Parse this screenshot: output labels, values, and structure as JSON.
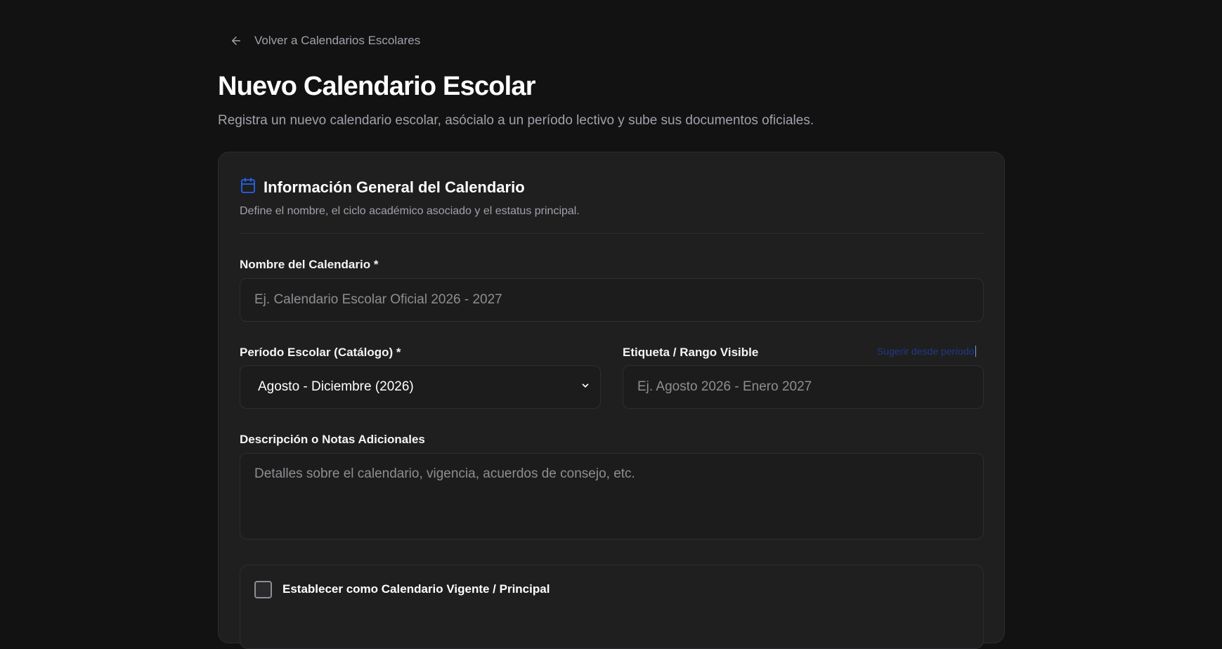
{
  "nav": {
    "back_label": "Volver a Calendarios Escolares"
  },
  "header": {
    "title": "Nuevo Calendario Escolar",
    "subtitle": "Registra un nuevo calendario escolar, asócialo a un período lectivo y sube sus documentos oficiales."
  },
  "section": {
    "title": "Información General del Calendario",
    "description": "Define el nombre, el ciclo académico asociado y el estatus principal."
  },
  "form": {
    "name": {
      "label": "Nombre del Calendario *",
      "placeholder": "Ej. Calendario Escolar Oficial 2026 - 2027",
      "value": ""
    },
    "period": {
      "label": "Período Escolar (Catálogo) *",
      "selected": "Agosto - Diciembre (2026)"
    },
    "tag": {
      "label": "Etiqueta / Rango Visible",
      "suggest_label": "Sugerir desde período",
      "placeholder": "Ej. Agosto 2026 - Enero 2027",
      "value": ""
    },
    "description": {
      "label": "Descripción o Notas Adicionales",
      "placeholder": "Detalles sobre el calendario, vigencia, acuerdos de consejo, etc.",
      "value": ""
    },
    "current": {
      "label": "Establecer como Calendario Vigente / Principal",
      "checked": false
    }
  },
  "colors": {
    "background": "#121212",
    "card": "#1f1f1f",
    "border": "#2e2e30",
    "accent": "#1e3a8a",
    "icon_accent": "#2563eb",
    "muted_text": "#a1a1aa"
  },
  "icons": {
    "back": "arrow-left-icon",
    "section": "calendar-icon",
    "select": "chevron-down-icon"
  }
}
